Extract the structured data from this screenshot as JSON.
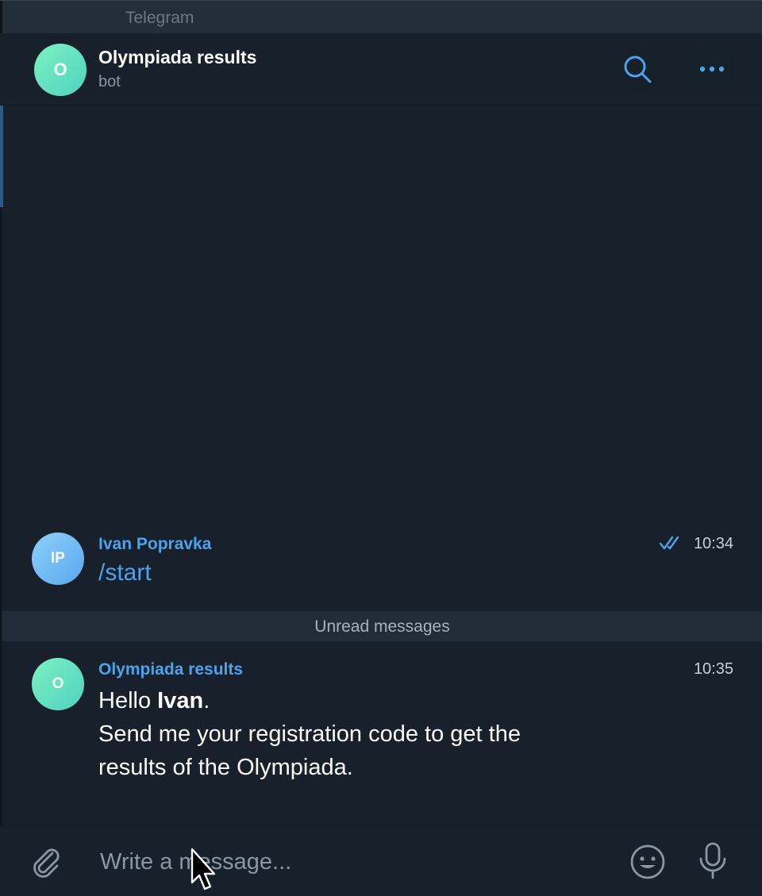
{
  "window": {
    "app_title": "Telegram"
  },
  "header": {
    "avatar_letter": "O",
    "title": "Olympiada results",
    "subtitle": "bot",
    "search_icon": "search-icon",
    "more_icon": "more-horizontal-icon"
  },
  "messages": [
    {
      "avatar_letters": "IP",
      "sender": "Ivan Popravka",
      "time": "10:34",
      "read_status": "double-check-icon",
      "text": "/start"
    },
    {
      "avatar_letter": "O",
      "sender": "Olympiada results",
      "time": "10:35",
      "line1_prefix": "Hello ",
      "line1_bold": "Ivan",
      "line1_suffix": ".",
      "line2": "Send me your registration code to get the",
      "line3": "results of the Olympiada."
    }
  ],
  "unread_divider": "Unread messages",
  "composer": {
    "placeholder": "Write a message...",
    "attach_icon": "paperclip-icon",
    "emoji_icon": "smile-icon",
    "mic_icon": "microphone-icon"
  },
  "colors": {
    "background": "#18202c",
    "accent": "#4aa3ed",
    "bot_avatar": "#5fe0c0",
    "user_avatar": "#6fb8f2"
  }
}
